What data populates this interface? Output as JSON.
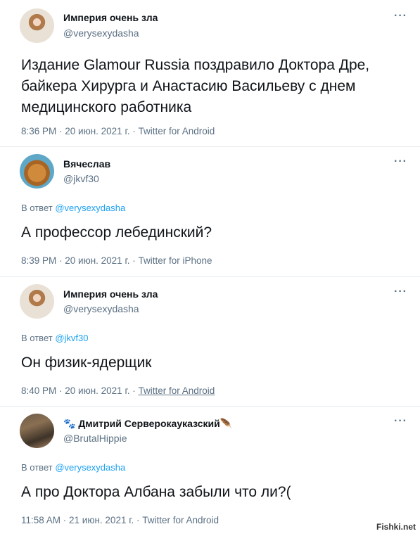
{
  "tweets": [
    {
      "name": "Империя очень зла",
      "handle": "@verysexydasha",
      "more": "···",
      "text": "Издание Glamour Russia поздравило Доктора Дре, байкера Хирурга и Анастасию Васильеву с днем медицинского работника",
      "meta": "8:36 PM · 20 июн. 2021 г. · Twitter for Android"
    },
    {
      "name": "Вячеслав",
      "handle": "@jkvf30",
      "more": "···",
      "reply_prefix": "В ответ ",
      "reply_to": "@verysexydasha",
      "text": "А профессор лебединский?",
      "meta": "8:39 PM · 20 июн. 2021 г. · Twitter for iPhone"
    },
    {
      "name": "Империя очень зла",
      "handle": "@verysexydasha",
      "more": "···",
      "reply_prefix": "В ответ ",
      "reply_to": "@jkvf30",
      "text": "Он физик-ядерщик",
      "meta_time": "8:40 PM · 20 июн. 2021 г. · ",
      "meta_source": "Twitter for Android"
    },
    {
      "name_emoji_left": "🐾",
      "name": "Дмитрий Серверокауказский",
      "name_emoji_right": "🪶",
      "handle": "@BrutalHippie",
      "more": "···",
      "reply_prefix": "В ответ ",
      "reply_to": "@verysexydasha",
      "text": "А про Доктора Албана забыли что ли?(",
      "meta": "11:58 AM · 21 июн. 2021 г. · Twitter for Android"
    }
  ],
  "watermark": "Fishki.net"
}
